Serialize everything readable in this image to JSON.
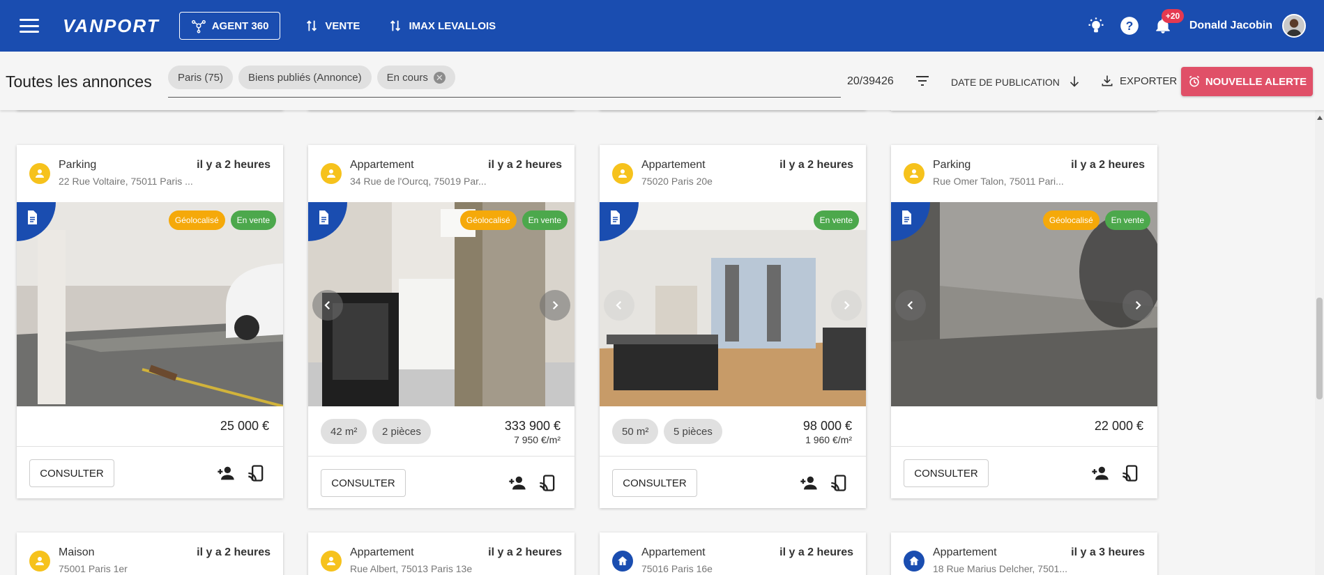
{
  "topbar": {
    "logo": "VANPORT",
    "nav": [
      {
        "label": "AGENT 360"
      },
      {
        "label": "VENTE"
      },
      {
        "label": "IMAX LEVALLOIS"
      }
    ],
    "notification_count": "+20",
    "user_name": "Donald Jacobin"
  },
  "filterbar": {
    "title": "Toutes les annonces",
    "chips": [
      "Paris (75)",
      "Biens publiés (Annonce)",
      "En cours"
    ],
    "count": "20/39426",
    "sort_label": "DATE DE PUBLICATION",
    "export_label": "EXPORTER",
    "new_alert_label": "NOUVELLE ALERTE"
  },
  "cards": [
    {
      "type": "Parking",
      "address": "22 Rue Voltaire, 75011 Paris ...",
      "time": "il y a 2 heures",
      "tags": [
        "Géolocalisé",
        "En vente"
      ],
      "price": "25 000 €",
      "consult": "CONSULTER"
    },
    {
      "type": "Appartement",
      "address": "34 Rue de l'Ourcq, 75019 Par...",
      "time": "il y a 2 heures",
      "tags": [
        "Géolocalisé",
        "En vente"
      ],
      "surface": "42 m²",
      "rooms": "2 pièces",
      "price": "333 900 €",
      "price_m2": "7 950 €/m²",
      "consult": "CONSULTER"
    },
    {
      "type": "Appartement",
      "address": "75020 Paris 20e",
      "time": "il y a 2 heures",
      "tags": [
        "En vente"
      ],
      "surface": "50 m²",
      "rooms": "5 pièces",
      "price": "98 000 €",
      "price_m2": "1 960 €/m²",
      "consult": "CONSULTER"
    },
    {
      "type": "Parking",
      "address": "Rue Omer Talon, 75011 Pari...",
      "time": "il y a 2 heures",
      "tags": [
        "Géolocalisé",
        "En vente"
      ],
      "price": "22 000 €",
      "consult": "CONSULTER"
    }
  ],
  "next_cards": [
    {
      "type": "Maison",
      "address": "75001 Paris 1er",
      "time": "il y a 2 heures",
      "avatar": "person"
    },
    {
      "type": "Appartement",
      "address": "Rue Albert, 75013 Paris 13e",
      "time": "il y a 2 heures",
      "avatar": "person"
    },
    {
      "type": "Appartement",
      "address": "75016 Paris 16e",
      "time": "il y a 2 heures",
      "avatar": "home"
    },
    {
      "type": "Appartement",
      "address": "18 Rue Marius Delcher, 7501...",
      "time": "il y a 3 heures",
      "avatar": "home"
    }
  ],
  "colors": {
    "primary": "#1a4db0",
    "alert": "#e05068",
    "geo_tag": "#f5a90a",
    "sale_tag": "#4ca84c",
    "avatar_yellow": "#f6c21c"
  }
}
